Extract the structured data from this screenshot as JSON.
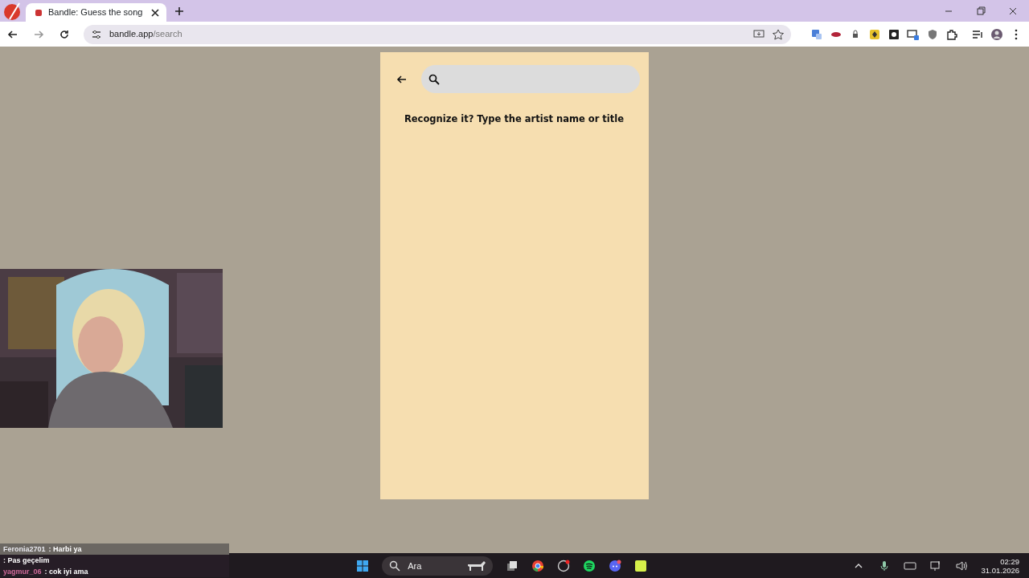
{
  "browser": {
    "tab_title": "Bandle: Guess the song",
    "address_host": "bandle.app",
    "address_path": "/search"
  },
  "page": {
    "prompt": "Recognize it? Type the artist name or title"
  },
  "chat": [
    {
      "user": "Feronia2701",
      "message": ": Harbi ya"
    },
    {
      "message": ": Pas geçelim"
    },
    {
      "user": "yagmur_06",
      "message": ": cok iyi ama"
    }
  ],
  "taskbar": {
    "search_placeholder": "Ara",
    "time": "02:29",
    "date": "31.01.2026"
  }
}
